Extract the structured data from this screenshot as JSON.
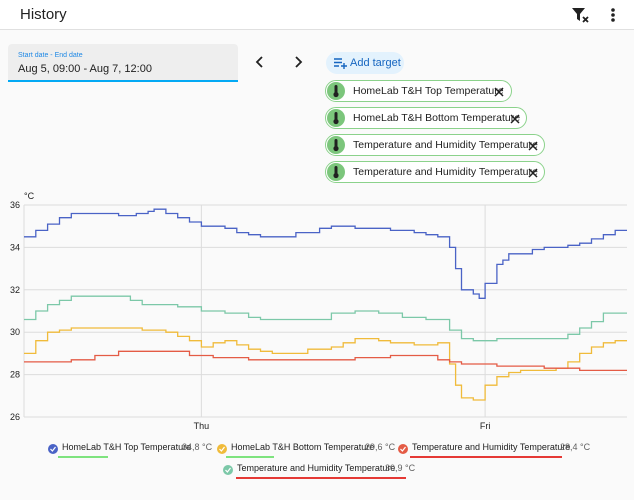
{
  "header": {
    "title": "History"
  },
  "date_picker": {
    "label": "Start date - End date",
    "value": "Aug 5, 09:00 - Aug 7, 12:00"
  },
  "add_target": {
    "label": "Add target"
  },
  "targets": [
    {
      "label": "HomeLab T&H Top Temperature"
    },
    {
      "label": "HomeLab T&H Bottom Temperature"
    },
    {
      "label": "Temperature and Humidity Temperature"
    },
    {
      "label": "Temperature and Humidity Temperature"
    }
  ],
  "colors": {
    "accent": "#03a9f4",
    "top": "#4a63c6",
    "bottom": "#f0bb3a",
    "th1": "#e45b45",
    "th2": "#7cc8a8",
    "chip_border": "#8bd28b",
    "underline_green": "#7ee37e",
    "underline_red": "#e53935"
  },
  "chart_data": {
    "type": "line",
    "ylabel": "°C",
    "ylim": [
      26,
      36
    ],
    "yticks": [
      "36",
      "34",
      "32",
      "30",
      "28",
      "26"
    ],
    "xlabels": [
      "Thu",
      "Fri"
    ],
    "grid": true,
    "x_unit": "hours since Aug 5 09:00",
    "xlim": [
      0,
      51
    ],
    "x_ticks_hours": [
      15,
      39
    ],
    "series": [
      {
        "name": "HomeLab T&H Top Temperature",
        "current": "34,8 °C",
        "color": "#4a63c6",
        "points": [
          [
            0,
            34.5
          ],
          [
            1,
            34.8
          ],
          [
            2,
            35.1
          ],
          [
            3,
            35.4
          ],
          [
            4,
            35.6
          ],
          [
            8,
            35.5
          ],
          [
            9.5,
            35.6
          ],
          [
            10.5,
            35.7
          ],
          [
            11,
            35.8
          ],
          [
            12,
            35.6
          ],
          [
            13,
            35.4
          ],
          [
            14,
            35.2
          ],
          [
            15,
            35.0
          ],
          [
            17,
            34.9
          ],
          [
            18,
            34.7
          ],
          [
            19,
            34.6
          ],
          [
            20,
            34.5
          ],
          [
            21,
            34.5
          ],
          [
            23,
            34.7
          ],
          [
            25,
            34.9
          ],
          [
            26,
            35.0
          ],
          [
            28,
            34.9
          ],
          [
            31,
            34.8
          ],
          [
            33,
            34.7
          ],
          [
            34,
            34.6
          ],
          [
            35,
            34.5
          ],
          [
            36,
            34.0
          ],
          [
            36.5,
            33.0
          ],
          [
            37,
            32.0
          ],
          [
            38,
            31.8
          ],
          [
            38.5,
            31.6
          ],
          [
            39,
            32.3
          ],
          [
            40,
            33.2
          ],
          [
            40.5,
            33.4
          ],
          [
            41,
            33.7
          ],
          [
            43,
            33.9
          ],
          [
            44,
            34.0
          ],
          [
            45,
            34.0
          ],
          [
            46,
            34.1
          ],
          [
            47,
            34.2
          ],
          [
            48,
            34.4
          ],
          [
            49,
            34.6
          ],
          [
            50,
            34.8
          ],
          [
            51,
            34.8
          ]
        ]
      },
      {
        "name": "HomeLab T&H Bottom Temperature",
        "current": "29,6 °C",
        "color": "#f0bb3a",
        "points": [
          [
            0,
            29.0
          ],
          [
            1,
            29.6
          ],
          [
            2,
            30.0
          ],
          [
            3,
            30.1
          ],
          [
            4,
            30.2
          ],
          [
            10,
            30.1
          ],
          [
            12,
            30.0
          ],
          [
            13,
            29.8
          ],
          [
            14,
            29.6
          ],
          [
            15,
            29.3
          ],
          [
            16,
            29.5
          ],
          [
            17,
            29.6
          ],
          [
            18,
            29.4
          ],
          [
            19,
            29.2
          ],
          [
            20,
            29.1
          ],
          [
            21,
            29.0
          ],
          [
            24,
            29.2
          ],
          [
            26,
            29.3
          ],
          [
            27,
            29.5
          ],
          [
            28,
            29.7
          ],
          [
            30,
            29.6
          ],
          [
            31,
            29.5
          ],
          [
            33,
            29.4
          ],
          [
            35,
            29.5
          ],
          [
            36,
            28.5
          ],
          [
            36.5,
            27.5
          ],
          [
            37,
            26.9
          ],
          [
            38,
            26.8
          ],
          [
            39,
            27.5
          ],
          [
            40,
            27.9
          ],
          [
            41,
            28.1
          ],
          [
            42,
            28.2
          ],
          [
            43,
            28.2
          ],
          [
            45,
            28.3
          ],
          [
            46,
            28.6
          ],
          [
            47,
            29.0
          ],
          [
            48,
            29.3
          ],
          [
            49,
            29.5
          ],
          [
            50,
            29.6
          ],
          [
            51,
            29.6
          ]
        ]
      },
      {
        "name": "Temperature and Humidity Temperature",
        "current": "28,4 °C",
        "color": "#e45b45",
        "points": [
          [
            0,
            28.6
          ],
          [
            3,
            28.6
          ],
          [
            4,
            28.7
          ],
          [
            6,
            28.9
          ],
          [
            8,
            29.1
          ],
          [
            13,
            29.1
          ],
          [
            14,
            28.9
          ],
          [
            16,
            28.8
          ],
          [
            19,
            28.7
          ],
          [
            24,
            28.7
          ],
          [
            28,
            28.8
          ],
          [
            31,
            28.9
          ],
          [
            35,
            28.7
          ],
          [
            36,
            28.6
          ],
          [
            37,
            28.5
          ],
          [
            40,
            28.4
          ],
          [
            44,
            28.3
          ],
          [
            47,
            28.2
          ],
          [
            51,
            28.2
          ]
        ]
      },
      {
        "name": "Temperature and Humidity Temperature",
        "current": "30,9 °C",
        "color": "#7cc8a8",
        "points": [
          [
            0,
            30.6
          ],
          [
            1,
            31.0
          ],
          [
            2,
            31.3
          ],
          [
            3,
            31.5
          ],
          [
            4,
            31.7
          ],
          [
            7,
            31.7
          ],
          [
            9,
            31.5
          ],
          [
            10,
            31.3
          ],
          [
            13,
            31.2
          ],
          [
            15,
            31.0
          ],
          [
            17,
            30.9
          ],
          [
            19,
            30.7
          ],
          [
            20,
            30.6
          ],
          [
            24,
            30.6
          ],
          [
            26,
            30.9
          ],
          [
            28,
            31.0
          ],
          [
            30,
            30.9
          ],
          [
            32,
            30.7
          ],
          [
            34,
            30.6
          ],
          [
            35,
            30.6
          ],
          [
            36,
            30.1
          ],
          [
            37,
            29.7
          ],
          [
            38,
            29.6
          ],
          [
            40,
            29.7
          ],
          [
            44,
            29.7
          ],
          [
            46,
            29.9
          ],
          [
            47,
            30.2
          ],
          [
            48,
            30.5
          ],
          [
            49,
            30.9
          ],
          [
            51,
            30.9
          ]
        ]
      }
    ]
  }
}
